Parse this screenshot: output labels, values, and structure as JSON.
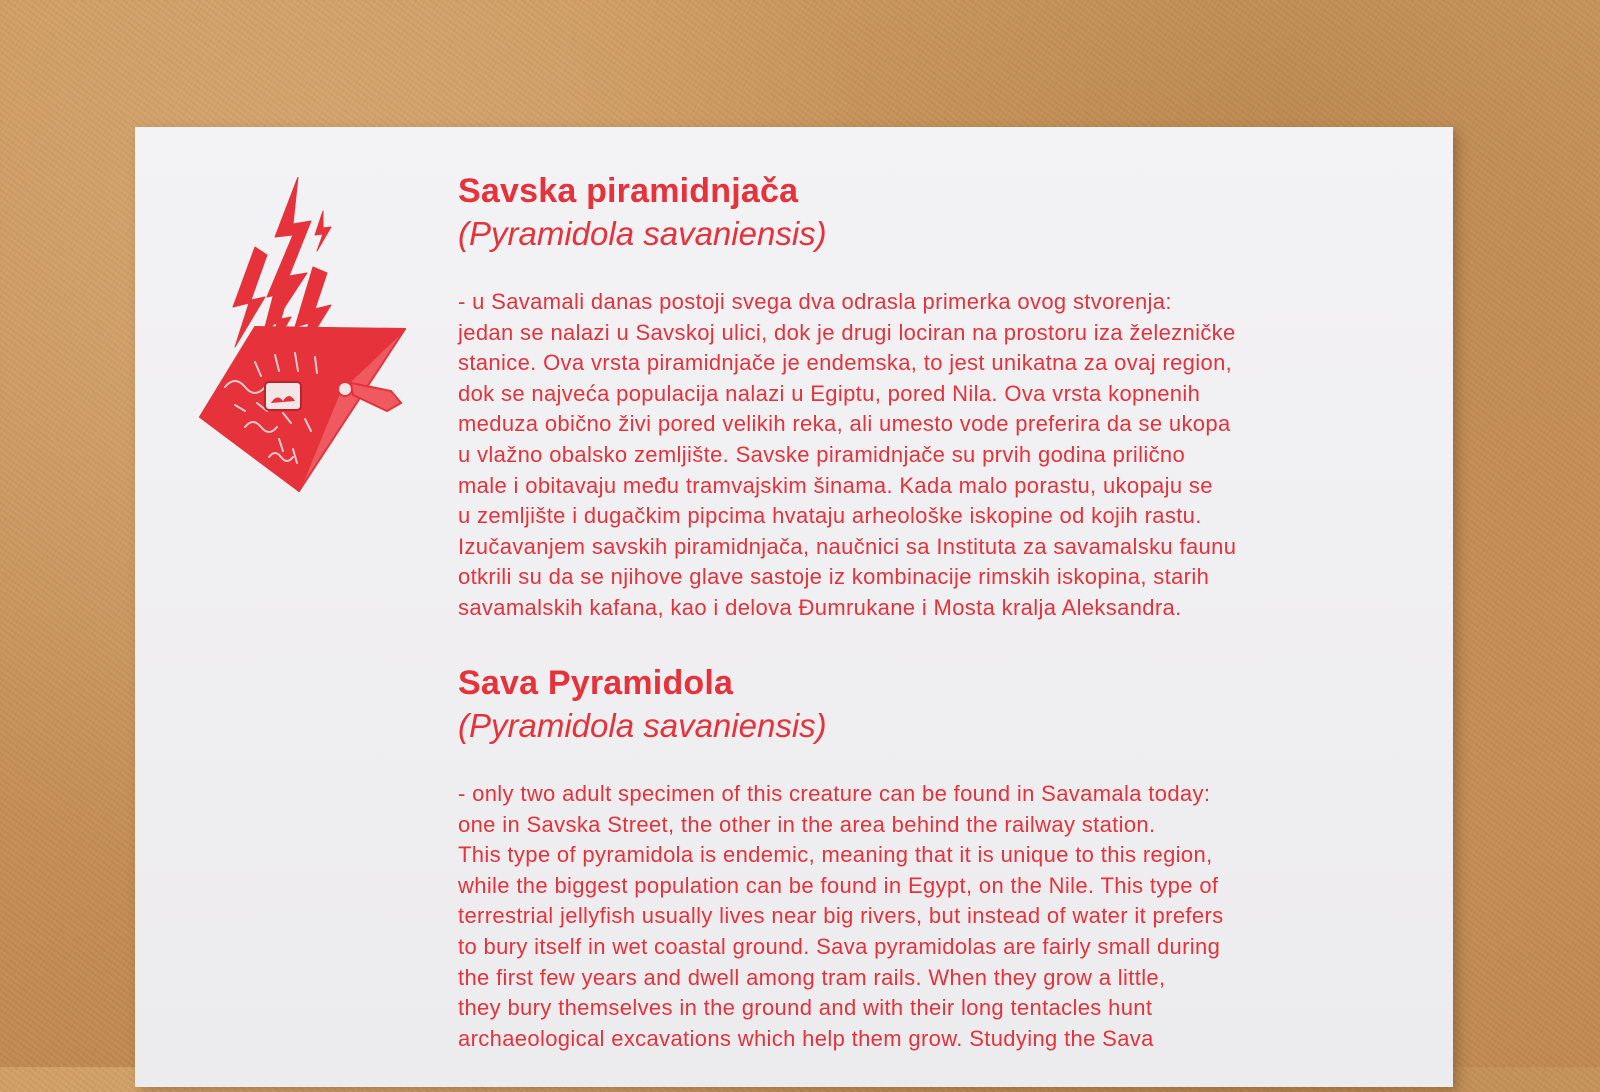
{
  "colors": {
    "ink": "#e5323b",
    "card": "#f0eff1",
    "board": "#c9955a"
  },
  "illustration": {
    "icon": "pyramid-creature-lightning-icon"
  },
  "serbian": {
    "title": "Savska piramidnjača",
    "latin_name": "(Pyramidola savaniensis)",
    "lines": [
      "- u Savamali danas postoji svega dva odrasla primerka ovog stvorenja:",
      "jedan se nalazi u Savskoj ulici, dok je drugi lociran na prostoru iza železničke",
      "stanice. Ova vrsta piramidnjače je endemska, to jest unikatna za ovaj region,",
      "dok se najveća populacija nalazi u Egiptu, pored Nila. Ova vrsta kopnenih",
      "meduza obično živi pored velikih reka, ali umesto vode preferira da se ukopa",
      "u vlažno obalsko zemljište. Savske piramidnjače su prvih godina prilično",
      "male i obitavaju među tramvajskim šinama. Kada malo porastu, ukopaju se",
      "u zemljište i dugačkim pipcima hvataju arheološke iskopine od kojih rastu.",
      "Izučavanjem savskih piramidnjača, naučnici sa Instituta za savamalsku faunu",
      "otkrili su da se njihove glave sastoje iz kombinacije rimskih iskopina, starih",
      "savamalskih kafana, kao i delova Đumrukane i Mosta kralja Aleksandra."
    ]
  },
  "english": {
    "title": "Sava Pyramidola",
    "latin_name": "(Pyramidola savaniensis)",
    "lines": [
      "- only two adult specimen of this creature can be found in Savamala today:",
      "one in Savska Street, the other in the area behind the railway station.",
      "This type of pyramidola is endemic, meaning that it is unique to this region,",
      "while the biggest population can be found in Egypt, on the Nile. This type of",
      "terrestrial jellyfish usually lives near big rivers, but instead of water it prefers",
      "to bury itself in wet coastal ground. Sava pyramidolas are fairly small during",
      "the first few years and dwell among tram rails. When they grow a little,",
      "they bury themselves in the ground and with their long tentacles hunt",
      "archaeological excavations which help them grow. Studying the Sava"
    ]
  }
}
